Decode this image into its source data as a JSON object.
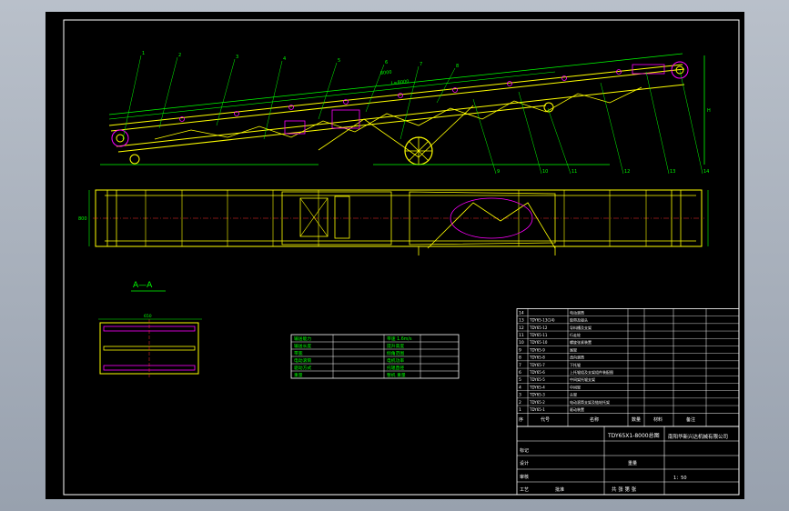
{
  "section_label": "A—A",
  "title_block": {
    "drawing_title": "TDY65X1-8000总图",
    "company": "南阳华新兴达机械有限公司",
    "scale": "1：50",
    "sheet": "共 张 第 张",
    "labels": {
      "seq": "序",
      "code": "代号",
      "name": "名称",
      "qty": "数量",
      "material": "材料",
      "note": "备注",
      "weight": "重量",
      "design": "设计",
      "check": "审核",
      "craft": "工艺",
      "approve": "批准",
      "mark": "标记"
    }
  },
  "parts": [
    {
      "no": "1",
      "code": "TDY65-1",
      "name": "驱动装置"
    },
    {
      "no": "2",
      "code": "TDY65-2",
      "name": "电动滚筒支架及链轮托架"
    },
    {
      "no": "3",
      "code": "TDY65-3",
      "name": "头架"
    },
    {
      "no": "4",
      "code": "TDY65-4",
      "name": "中间架"
    },
    {
      "no": "5",
      "code": "TDY65-5",
      "name": "中间架托辊支架"
    },
    {
      "no": "6",
      "code": "TDY65-6",
      "name": "上托辊组及支架组件装配图"
    },
    {
      "no": "7",
      "code": "TDY65-7",
      "name": "下托辊"
    },
    {
      "no": "8",
      "code": "TDY65-8",
      "name": "改向滚筒"
    },
    {
      "no": "9",
      "code": "TDY65-9",
      "name": "尾架"
    },
    {
      "no": "10",
      "code": "TDY65-10",
      "name": "螺旋张紧装置"
    },
    {
      "no": "11",
      "code": "TDY65-11",
      "name": "行走轮"
    },
    {
      "no": "12",
      "code": "TDY65-12",
      "name": "导料槽及支架"
    },
    {
      "no": "13",
      "code": "TDY65-13(14)",
      "name": "胶带及接头"
    },
    {
      "no": "14",
      "code": "",
      "name": "电动滚筒"
    }
  ],
  "tech_table": [
    [
      "输送能力",
      "",
      "带速 1.6m/s"
    ],
    [
      "输送长度",
      "",
      "提升高度"
    ],
    [
      "带宽",
      "",
      "倾角范围"
    ],
    [
      "电动滚筒",
      "",
      "电机功率"
    ],
    [
      "驱动方式",
      "",
      "托辊直径"
    ],
    [
      "重量",
      "",
      "整机 重量"
    ]
  ],
  "callouts": [
    "1",
    "2",
    "3",
    "4",
    "5",
    "6",
    "7",
    "8",
    "9",
    "10",
    "11",
    "12",
    "13",
    "14"
  ],
  "dimension_labels": {
    "overall_length": "8000",
    "incline_length": "L=8000",
    "height": "H",
    "width": "800",
    "section_width": "650"
  },
  "colors": {
    "sheet": "#000000",
    "belt_frame": "#ffff00",
    "dimension": "#00ff00",
    "part_detail": "#ff00ff",
    "center_line": "#ff3030",
    "table_line": "#ffffff",
    "hatching": "#00ffff"
  }
}
